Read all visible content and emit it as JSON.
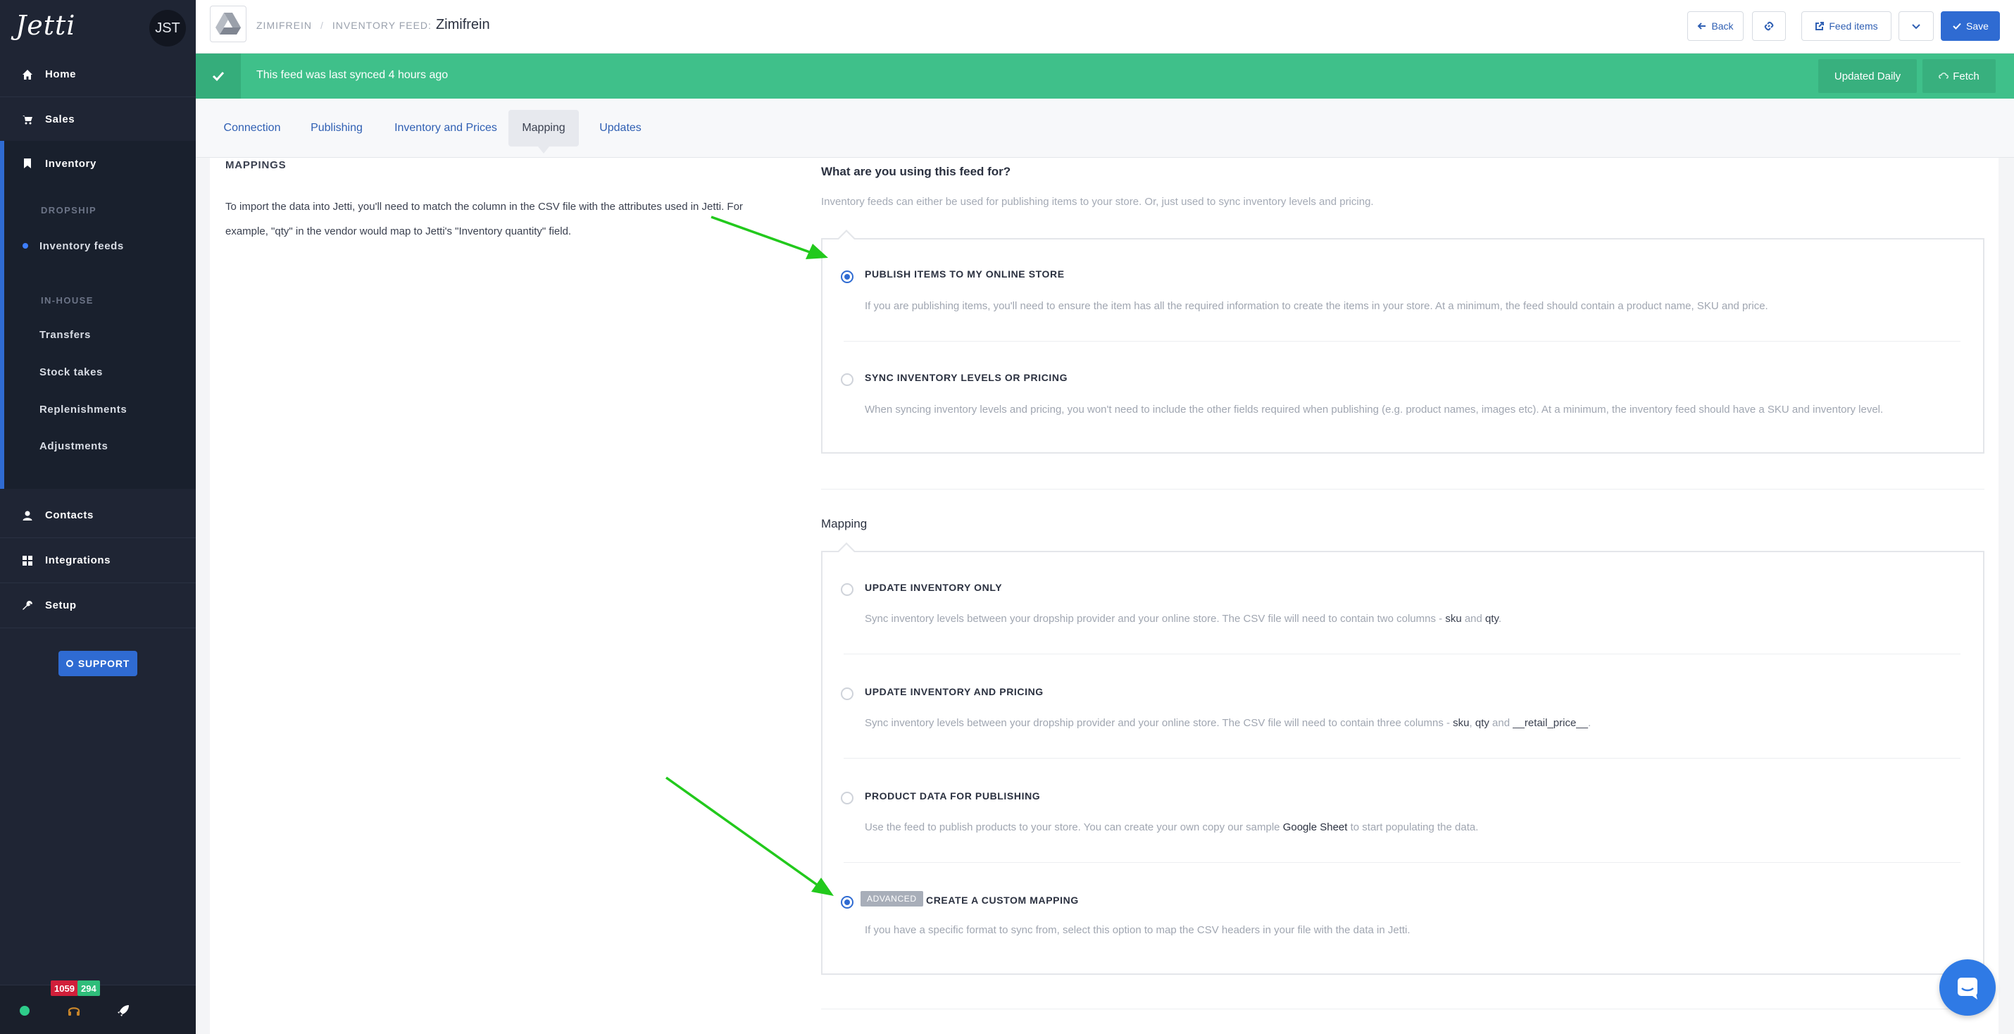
{
  "sidebar": {
    "logo": "Jetti",
    "avatar": "JST",
    "nav": {
      "home": "Home",
      "sales": "Sales",
      "inventory": "Inventory",
      "contacts": "Contacts",
      "integrations": "Integrations",
      "setup": "Setup"
    },
    "sections": {
      "dropship": "DROPSHIP",
      "inhouse": "IN-HOUSE"
    },
    "sub_items": {
      "inventory_feeds": "Inventory feeds",
      "transfers": "Transfers",
      "stock_takes": "Stock takes",
      "replenishments": "Replenishments",
      "adjustments": "Adjustments"
    },
    "support": "SUPPORT",
    "badges": {
      "red": "1059",
      "green": "294"
    }
  },
  "header": {
    "crumb_vendor": "ZIMIFREIN",
    "crumb_type": "INVENTORY FEED:",
    "title": "Zimifrein",
    "back": "Back",
    "feed_items": "Feed items",
    "save": "Save"
  },
  "banner": {
    "text": "This feed was last synced 4 hours ago",
    "updated": "Updated Daily",
    "fetch": "Fetch"
  },
  "tabs": [
    "Connection",
    "Publishing",
    "Inventory and Prices",
    "Mapping",
    "Updates"
  ],
  "left": {
    "heading": "MAPPINGS",
    "text": "To import the data into Jetti, you'll need to match the column in the CSV file with the attributes used in Jetti. For example, \"qty\" in the vendor would map to Jetti's \"Inventory quantity\" field."
  },
  "usage": {
    "title": "What are you using this feed for?",
    "subtitle": "Inventory feeds can either be used for publishing items to your store. Or, just used to sync inventory levels and pricing.",
    "options": [
      {
        "label": "PUBLISH ITEMS TO MY ONLINE STORE",
        "desc": "If you are publishing items, you'll need to ensure the item has all the required information to create the items in your store. At a minimum, the feed should contain a product name, SKU and price.",
        "checked": true
      },
      {
        "label": "SYNC INVENTORY LEVELS OR PRICING",
        "desc": "When syncing inventory levels and pricing, you won't need to include the other fields required when publishing (e.g. product names, images etc). At a minimum, the inventory feed should have a SKU and inventory level.",
        "checked": false
      }
    ]
  },
  "mapping": {
    "title": "Mapping",
    "options": [
      {
        "label": "UPDATE INVENTORY ONLY",
        "desc_pre": "Sync inventory levels between your dropship provider and your online store. The CSV file will need to contain two columns - ",
        "k1": "sku",
        "mid": " and ",
        "k2": "qty",
        "end": "."
      },
      {
        "label": "UPDATE INVENTORY AND PRICING",
        "desc_pre": "Sync inventory levels between your dropship provider and your online store. The CSV file will need to contain three columns - ",
        "k1": "sku",
        "comma": ", ",
        "k2": "qty",
        "mid": " and ",
        "k3": "__retail_price__",
        "end": "."
      },
      {
        "label": "PRODUCT DATA FOR PUBLISHING",
        "desc_pre": "Use the feed to publish products to your store. You can create your own copy our sample ",
        "link": "Google Sheet",
        "end": " to start populating the data."
      },
      {
        "tag": "ADVANCED",
        "label": "CREATE A CUSTOM MAPPING",
        "desc": "If you have a specific format to sync from, select this option to map the CSV headers in your file with the data in Jetti."
      }
    ]
  },
  "colors": {
    "accent": "#2f6bd2",
    "banner": "#3fc08a",
    "sidebar": "#1f2534",
    "arrow": "#22c91c"
  }
}
